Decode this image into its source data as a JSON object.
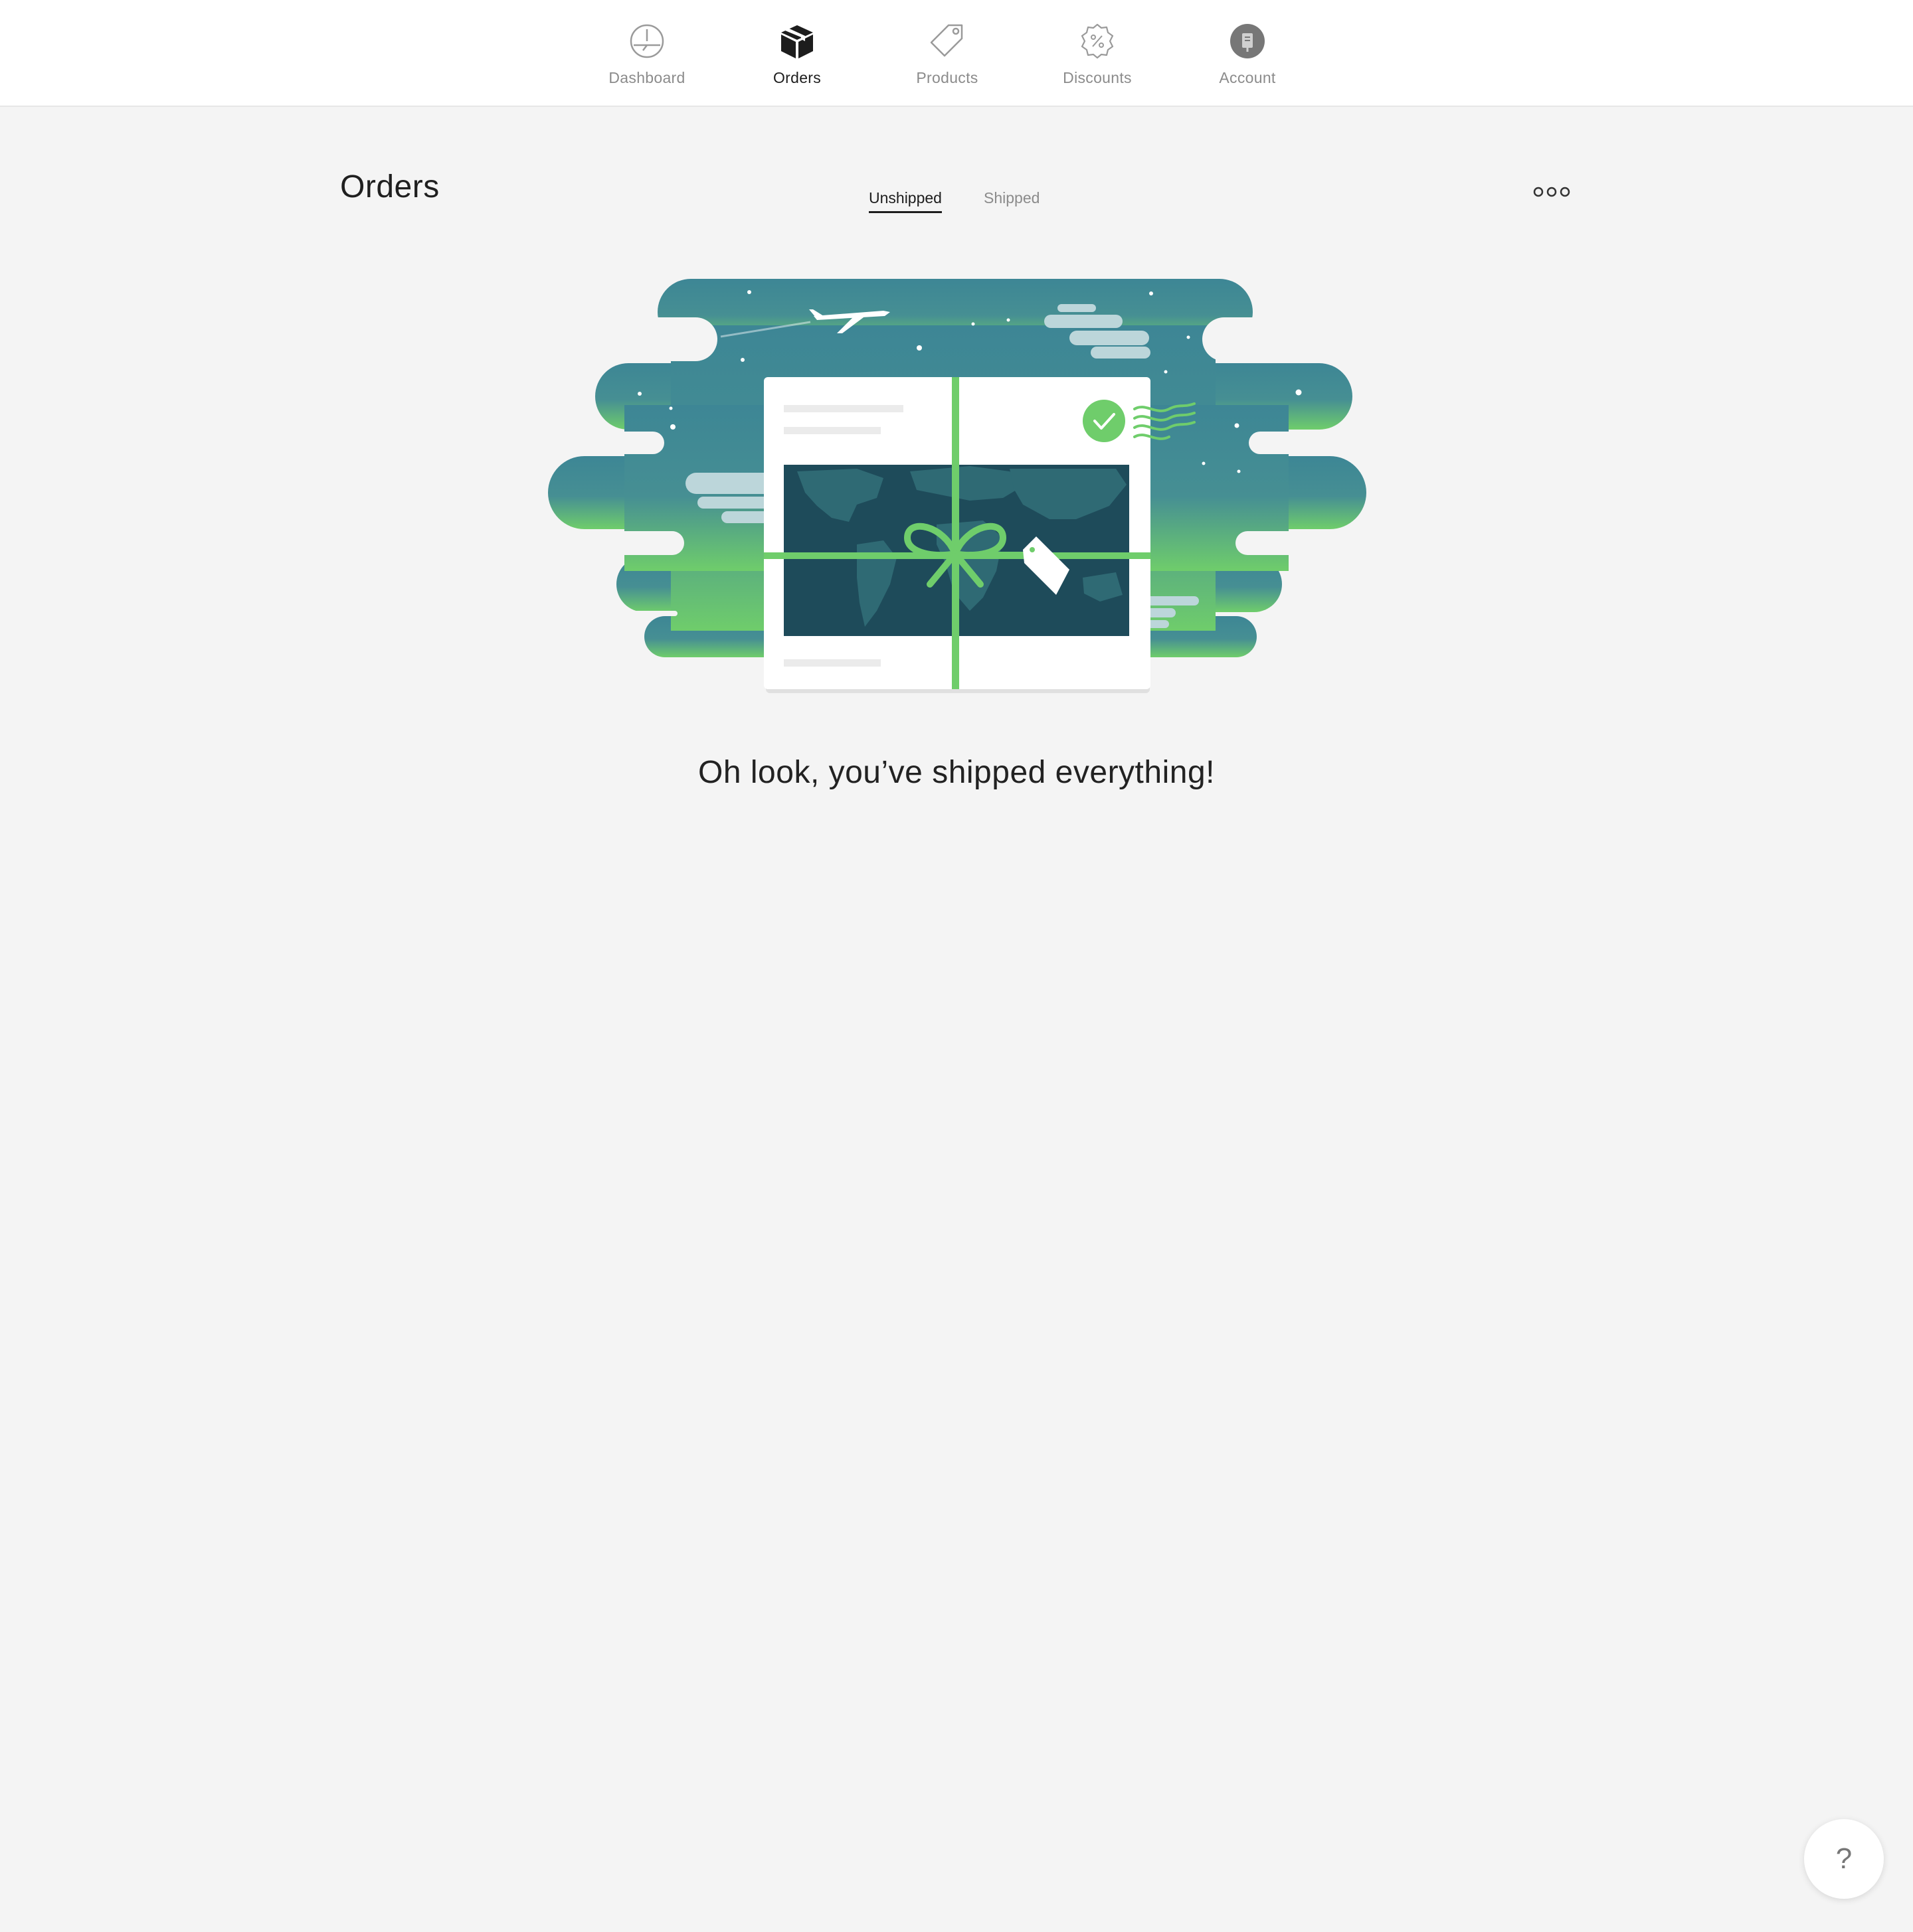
{
  "nav": {
    "items": [
      {
        "label": "Dashboard",
        "icon": "dashboard-icon",
        "active": false
      },
      {
        "label": "Orders",
        "icon": "box-icon",
        "active": true
      },
      {
        "label": "Products",
        "icon": "tag-icon",
        "active": false
      },
      {
        "label": "Discounts",
        "icon": "discount-icon",
        "active": false
      },
      {
        "label": "Account",
        "icon": "account-icon",
        "active": false
      }
    ]
  },
  "page": {
    "title": "Orders",
    "tabs": [
      {
        "label": "Unshipped",
        "active": true
      },
      {
        "label": "Shipped",
        "active": false
      }
    ],
    "more_icon": "more-options-icon",
    "empty_message": "Oh look, you’ve shipped everything!"
  },
  "help": {
    "label": "?",
    "icon": "help-icon"
  },
  "colors": {
    "accent_green": "#6fcd6b",
    "sky_top": "#3d8695",
    "sky_bottom": "#6fcd6b",
    "map_dark": "#1e4b5a",
    "page_bg": "#f4f4f4"
  }
}
